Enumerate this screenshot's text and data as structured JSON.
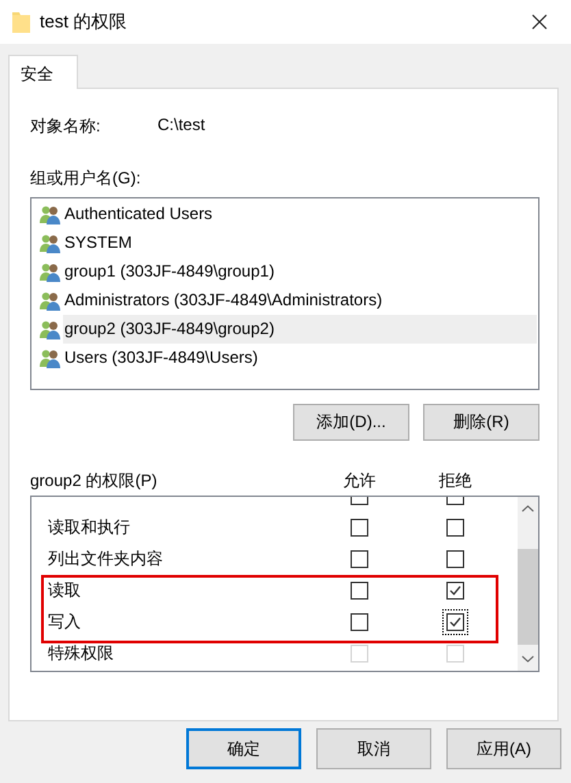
{
  "window": {
    "title": "test 的权限"
  },
  "tabs": [
    {
      "label": "安全",
      "selected": true
    }
  ],
  "object_name": {
    "label": "对象名称:",
    "value": "C:\\test"
  },
  "groups": {
    "label": "组或用户名(G):",
    "items": [
      {
        "name": "Authenticated Users",
        "selected": false
      },
      {
        "name": "SYSTEM",
        "selected": false
      },
      {
        "name": "group1 (303JF-4849\\group1)",
        "selected": false
      },
      {
        "name": "Administrators (303JF-4849\\Administrators)",
        "selected": false
      },
      {
        "name": "group2 (303JF-4849\\group2)",
        "selected": true
      },
      {
        "name": "Users (303JF-4849\\Users)",
        "selected": false
      }
    ]
  },
  "group_buttons": [
    "添加(D)...",
    "删除(R)"
  ],
  "permissions": {
    "label": "group2 的权限(P)",
    "columns": [
      "允许",
      "拒绝"
    ],
    "rows": [
      {
        "kind": "partial",
        "disabled": false,
        "highlighted": false,
        "deny_focused": false
      },
      {
        "kind": "normal",
        "label": "读取和执行",
        "allow": false,
        "deny": false,
        "disabled": false,
        "highlighted": false,
        "deny_focused": false
      },
      {
        "kind": "normal",
        "label": "列出文件夹内容",
        "allow": false,
        "deny": false,
        "disabled": false,
        "highlighted": false,
        "deny_focused": false
      },
      {
        "kind": "normal",
        "label": "读取",
        "allow": false,
        "deny": true,
        "disabled": false,
        "highlighted": true,
        "deny_focused": false
      },
      {
        "kind": "normal",
        "label": "写入",
        "allow": false,
        "deny": true,
        "disabled": false,
        "highlighted": true,
        "deny_focused": true
      },
      {
        "kind": "normal",
        "label": "特殊权限",
        "allow": false,
        "deny": false,
        "disabled": true,
        "highlighted": false,
        "deny_focused": false
      }
    ]
  },
  "dialog_buttons": [
    {
      "label": "确定",
      "default": true
    },
    {
      "label": "取消",
      "default": false
    },
    {
      "label": "应用(A)",
      "default": false
    }
  ]
}
